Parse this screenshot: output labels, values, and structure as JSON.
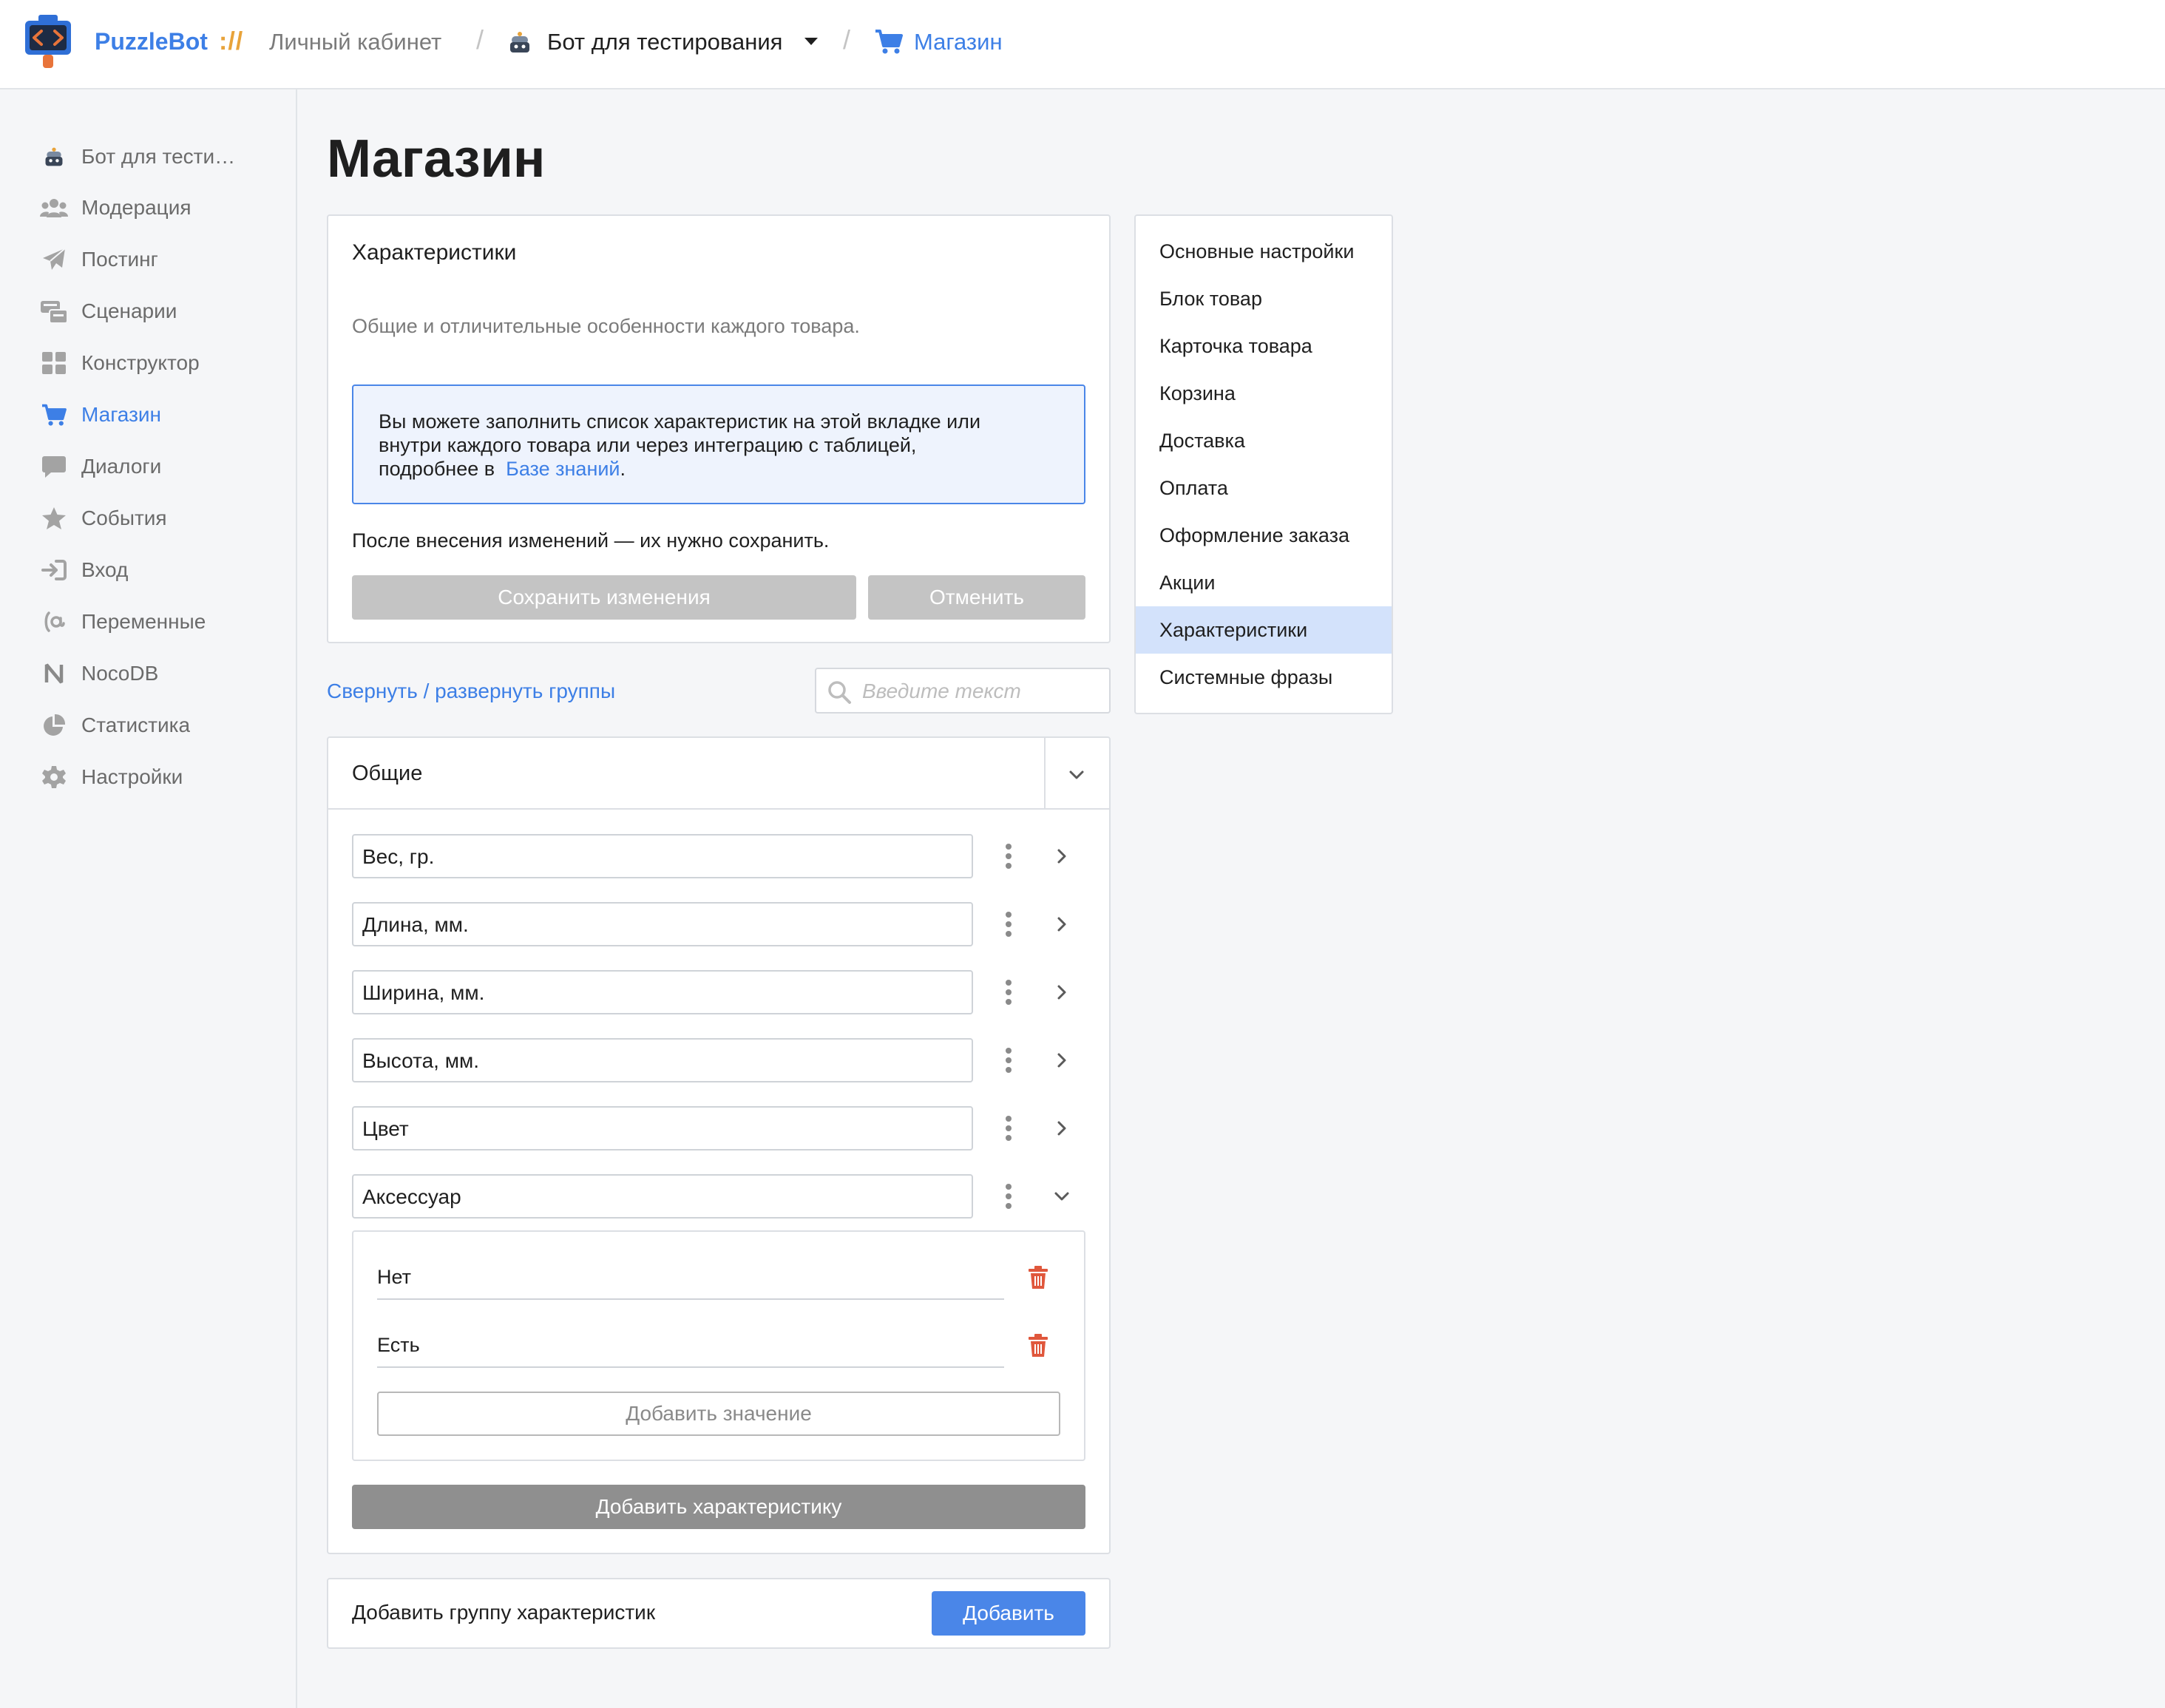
{
  "header": {
    "brand": "PuzzleBot",
    "brand_separator": "://",
    "crumb_cabinet": "Личный кабинет",
    "crumb_bot": "Бот для тестирования",
    "crumb_shop": "Магазин",
    "accent_color": "#3d7fe6"
  },
  "sidebar": {
    "items": [
      {
        "label": "Бот для тести…",
        "icon": "bot-avatar-icon"
      },
      {
        "label": "Модерация",
        "icon": "users-icon"
      },
      {
        "label": "Постинг",
        "icon": "paper-plane-icon"
      },
      {
        "label": "Сценарии",
        "icon": "scenario-icon"
      },
      {
        "label": "Конструктор",
        "icon": "grid-icon"
      },
      {
        "label": "Магазин",
        "icon": "cart-icon",
        "active": true
      },
      {
        "label": "Диалоги",
        "icon": "chat-icon"
      },
      {
        "label": "События",
        "icon": "star-icon"
      },
      {
        "label": "Вход",
        "icon": "sign-in-icon"
      },
      {
        "label": "Переменные",
        "icon": "variable-icon"
      },
      {
        "label": "NocoDB",
        "icon": "nocodb-icon"
      },
      {
        "label": "Статистика",
        "icon": "pie-chart-icon"
      },
      {
        "label": "Настройки",
        "icon": "gear-icon"
      }
    ]
  },
  "main": {
    "page_title": "Магазин",
    "card": {
      "title": "Характеристики",
      "description": "Общие и отличительные особенности каждого товара.",
      "info_line1": "Вы можете заполнить список характеристик на этой вкладке или",
      "info_line2": "внутри каждого товара или через интеграцию с таблицей,",
      "info_line3_prefix": "подробнее в",
      "info_link": "Базе знаний",
      "info_line3_suffix": ".",
      "save_notice": "После внесения изменений — их нужно сохранить.",
      "save_button": "Сохранить изменения",
      "cancel_button": "Отменить"
    },
    "toggle_groups_link": "Свернуть / развернуть группы",
    "search": {
      "placeholder": "Введите текст",
      "value": ""
    },
    "group": {
      "name": "Общие",
      "fields": [
        {
          "value": "Вес, гр."
        },
        {
          "value": "Длина, мм."
        },
        {
          "value": "Ширина, мм."
        },
        {
          "value": "Высота, мм."
        },
        {
          "value": "Цвет"
        },
        {
          "value": "Аксессуар"
        }
      ],
      "values": [
        {
          "value": "Нет"
        },
        {
          "value": "Есть"
        }
      ],
      "add_value_button": "Добавить значение",
      "add_characteristic_button": "Добавить характеристику"
    },
    "add_group": {
      "label": "Добавить группу характеристик",
      "button": "Добавить"
    }
  },
  "right_menu": {
    "items": [
      {
        "label": "Основные настройки"
      },
      {
        "label": "Блок товар"
      },
      {
        "label": "Карточка товара"
      },
      {
        "label": "Корзина"
      },
      {
        "label": "Доставка"
      },
      {
        "label": "Оплата"
      },
      {
        "label": "Оформление заказа"
      },
      {
        "label": "Акции"
      },
      {
        "label": "Характеристики",
        "active": true
      },
      {
        "label": "Системные фразы"
      }
    ]
  }
}
